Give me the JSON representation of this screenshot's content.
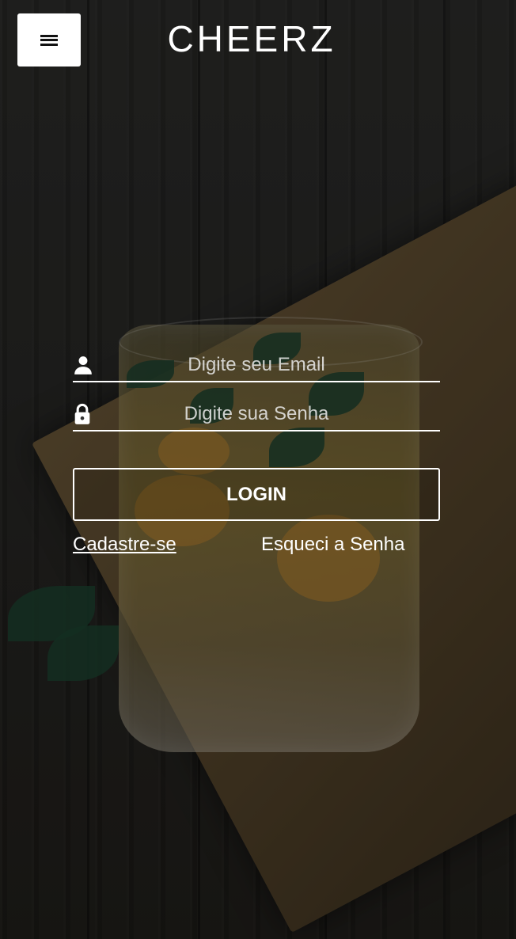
{
  "header": {
    "menu_icon": "hamburger-menu-icon",
    "logo_text": "CHEERZ"
  },
  "form": {
    "email": {
      "icon": "user-icon",
      "placeholder": "Digite seu Email",
      "value": ""
    },
    "password": {
      "icon": "lock-icon",
      "placeholder": "Digite sua Senha",
      "value": ""
    },
    "login_label": "LOGIN",
    "signup_label": "Cadastre-se",
    "forgot_label": "Esqueci a Senha"
  },
  "colors": {
    "text": "#ffffff",
    "menu_button_bg": "#ffffff",
    "overlay": "#1d1d1b"
  }
}
